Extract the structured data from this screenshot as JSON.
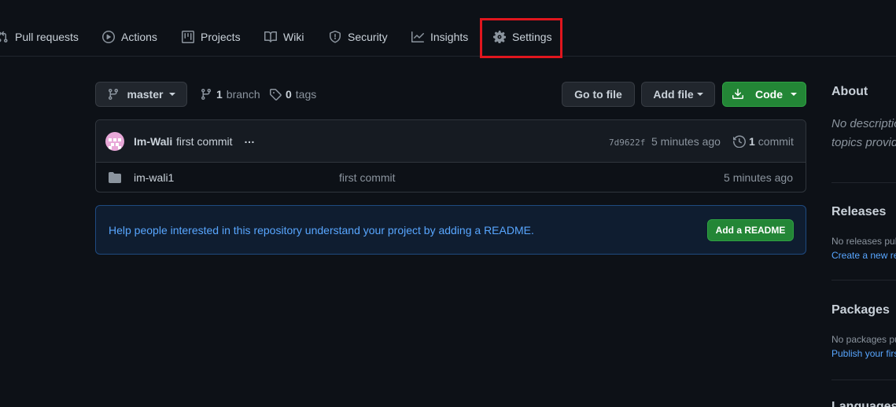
{
  "nav": {
    "items": [
      {
        "label": "Pull requests",
        "icon": "pull-request-icon"
      },
      {
        "label": "Actions",
        "icon": "play-icon"
      },
      {
        "label": "Projects",
        "icon": "project-icon"
      },
      {
        "label": "Wiki",
        "icon": "book-icon"
      },
      {
        "label": "Security",
        "icon": "shield-icon"
      },
      {
        "label": "Insights",
        "icon": "graph-icon"
      },
      {
        "label": "Settings",
        "icon": "gear-icon"
      }
    ],
    "highlighted": "Settings",
    "highlight_color": "#e0161e"
  },
  "toolbar": {
    "branch_button": "master",
    "branch_count": "1",
    "branch_word": "branch",
    "tag_count": "0",
    "tag_word": "tags",
    "go_to_file": "Go to file",
    "add_file": "Add file",
    "code": "Code"
  },
  "commit": {
    "author": "Im-Wali",
    "message": "first commit",
    "more": "…",
    "sha": "7d9622f",
    "time": "5 minutes ago",
    "count": "1",
    "count_word": "commit"
  },
  "files": [
    {
      "name": "im-wali1",
      "type": "folder",
      "message": "first commit",
      "time": "5 minutes ago"
    }
  ],
  "readme_banner": {
    "text": "Help people interested in this repository understand your project by adding a README.",
    "button": "Add a README"
  },
  "sidebar": {
    "about_title": "About",
    "about_desc": "No description, website, or topics provided.",
    "releases_title": "Releases",
    "releases_text": "No releases published",
    "releases_link": "Create a new release",
    "packages_title": "Packages",
    "packages_text": "No packages published",
    "packages_link": "Publish your first package",
    "languages_title": "Languages"
  },
  "colors": {
    "background": "#0d1117",
    "accent_green": "#238636",
    "link_blue": "#58a6ff"
  }
}
